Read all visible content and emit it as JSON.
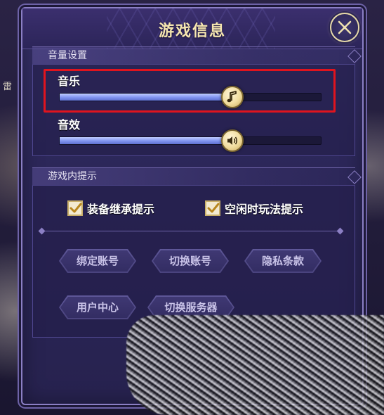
{
  "dialog": {
    "title": "游戏信息",
    "close_icon": "close-x-icon"
  },
  "volume": {
    "section_title": "音量设置",
    "music": {
      "label": "音乐",
      "level": 0.66,
      "icon": "music-note-icon"
    },
    "sfx": {
      "label": "音效",
      "level": 0.66,
      "icon": "speaker-icon"
    }
  },
  "hints": {
    "section_title": "游戏内提示",
    "options": [
      {
        "label": "装备继承提示",
        "checked": true
      },
      {
        "label": "空闲时玩法提示",
        "checked": true
      }
    ]
  },
  "buttons": {
    "bind_account": "绑定账号",
    "switch_account": "切换账号",
    "privacy": "隐私条款",
    "user_center": "用户中心",
    "switch_server": "切换服务器"
  },
  "background": {
    "side_char": "雷"
  },
  "colors": {
    "title": "#f5e6b0",
    "highlight": "#e0141e",
    "slider_fill": "#7f93f0",
    "panel": "#2c2759"
  }
}
